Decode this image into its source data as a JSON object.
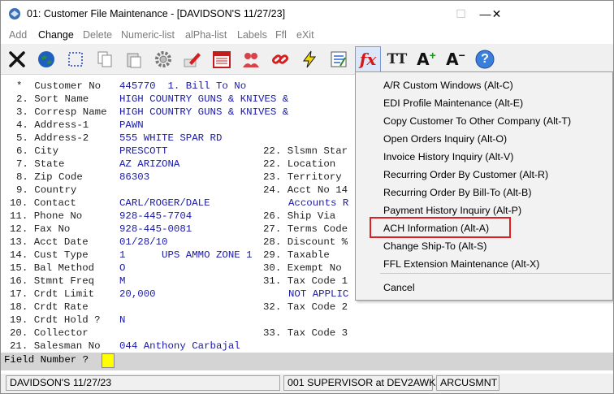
{
  "window": {
    "title": "01: Customer File Maintenance - [DAVIDSON'S 11/27/23]",
    "minimize": "—",
    "maximize": "☐",
    "close": "✕"
  },
  "menu": [
    {
      "label": "Add",
      "active": false
    },
    {
      "label": "Change",
      "active": true
    },
    {
      "label": "Delete",
      "active": false
    },
    {
      "label": "Numeric-list",
      "active": false
    },
    {
      "label": "alPha-list",
      "active": false
    },
    {
      "label": "Labels",
      "active": false
    },
    {
      "label": "Ffl",
      "active": false
    },
    {
      "label": "eXit",
      "active": false
    }
  ],
  "toolbar": {
    "icons": [
      "exit-icon",
      "globe-icon",
      "select-icon",
      "copy-icon",
      "paste-icon",
      "settings-icon",
      "edit-icon",
      "calendar-icon",
      "users-icon",
      "link-icon",
      "lightning-icon",
      "notes-icon",
      "fx-icon",
      "font-icon",
      "increase-font-icon",
      "decrease-font-icon",
      "help-icon"
    ],
    "fx": "fx",
    "tt": "TT",
    "a_plus": "A",
    "a_minus": "A",
    "help": "?"
  },
  "terminal": {
    "r0": {
      "label": "*  Customer No",
      "value": "445770  1. Bill To No"
    },
    "r1": {
      "label": "2. Sort Name",
      "value": "HIGH COUNTRY GUNS & KNIVES &"
    },
    "r2": {
      "label": "3. Corresp Name",
      "value": "HIGH COUNTRY GUNS & KNIVES &"
    },
    "r3": {
      "label": "4. Address-1",
      "value": "PAWN"
    },
    "r4": {
      "label": "5. Address-2",
      "value": "555 WHITE SPAR RD"
    },
    "r5": {
      "label": "6. City",
      "value": "PRESCOTT",
      "right": "22. Slsmn Star"
    },
    "r6": {
      "label": "7. State",
      "value": "AZ ARIZONA",
      "right": "22. Location"
    },
    "r7": {
      "label": "8. Zip Code",
      "value": "86303",
      "right": "23. Territory"
    },
    "r8": {
      "label": "9. Country",
      "value": "",
      "right": "24. Acct No 14"
    },
    "r9": {
      "label": "10. Contact",
      "value": "CARL/ROGER/DALE",
      "right": "Accounts R"
    },
    "r10": {
      "label": "11. Phone No",
      "value": "928-445-7704",
      "right": "26. Ship Via"
    },
    "r11": {
      "label": "12. Fax No",
      "value": "928-445-0081",
      "right": "27. Terms Code"
    },
    "r12": {
      "label": "13. Acct Date",
      "value": "01/28/10",
      "right": "28. Discount %"
    },
    "r13": {
      "label": "14. Cust Type",
      "value": "1      UPS AMMO ZONE 1",
      "right": "29. Taxable"
    },
    "r14": {
      "label": "15. Bal Method",
      "value": "O",
      "right": "30. Exempt No"
    },
    "r15": {
      "label": "16. Stmnt Freq",
      "value": "M",
      "right": "31. Tax Code 1"
    },
    "r16": {
      "label": "17. Crdt Limit",
      "value": "20,000",
      "right": "NOT APPLIC"
    },
    "r17": {
      "label": "18. Crdt Rate",
      "value": "",
      "right": "32. Tax Code 2"
    },
    "r18": {
      "label": "19. Crdt Hold ?",
      "value": "N",
      "right": ""
    },
    "r19": {
      "label": "20. Collector",
      "value": "",
      "right": "33. Tax Code 3"
    },
    "r20": {
      "label": "21. Salesman No",
      "value": "044 Anthony Carbajal",
      "right": ""
    }
  },
  "field_prompt": "Field Number ?",
  "status": {
    "company": "DAVIDSON'S 11/27/23",
    "user": "001 SUPERVISOR at DEV2AWK",
    "program": "ARCUSMNT"
  },
  "context_menu": {
    "items": [
      "A/R Custom Windows (Alt-C)",
      "EDI Profile Maintenance (Alt-E)",
      "Copy Customer To Other Company (Alt-T)",
      "Open Orders Inquiry (Alt-O)",
      "Invoice History Inquiry (Alt-V)",
      "Recurring Order By Customer (Alt-R)",
      "Recurring Order By Bill-To (Alt-B)",
      "Payment History Inquiry (Alt-P)",
      "ACH Information (Alt-A)",
      "Change Ship-To (Alt-S)",
      "FFL Extension Maintenance (Alt-X)"
    ],
    "cancel": "Cancel",
    "highlighted_index": 8,
    "highlight_color": "#e02020"
  }
}
